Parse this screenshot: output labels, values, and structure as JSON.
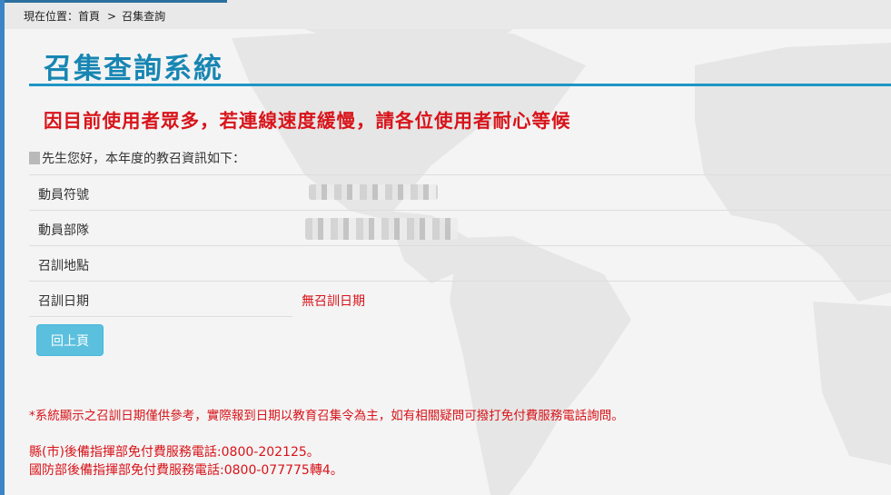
{
  "breadcrumb": {
    "prefix": "現在位置：首頁",
    "separator": ">",
    "current": "召集查詢"
  },
  "title": "召集查詢系統",
  "notice": "因目前使用者眾多，若連線速度緩慢，請各位使用者耐心等候",
  "greeting": "先生您好，本年度的教召資訊如下：",
  "rows": [
    {
      "label": "動員符號",
      "value": ""
    },
    {
      "label": "動員部隊",
      "value": ""
    },
    {
      "label": "召訓地點",
      "value": ""
    },
    {
      "label": "召訓日期",
      "value": "無召訓日期"
    }
  ],
  "back_button": "回上頁",
  "footnote": "*系統顯示之召訓日期僅供參考，實際報到日期以教育召集令為主，如有相關疑問可撥打免付費服務電話詢問。",
  "hotlines": [
    "縣(市)後備指揮部免付費服務電話:0800-202125。",
    "國防部後備指揮部免付費服務電話:0800-077775轉4。"
  ],
  "colors": {
    "accent": "#1786b3",
    "alert": "#d8141a",
    "button": "#5bc0de"
  }
}
